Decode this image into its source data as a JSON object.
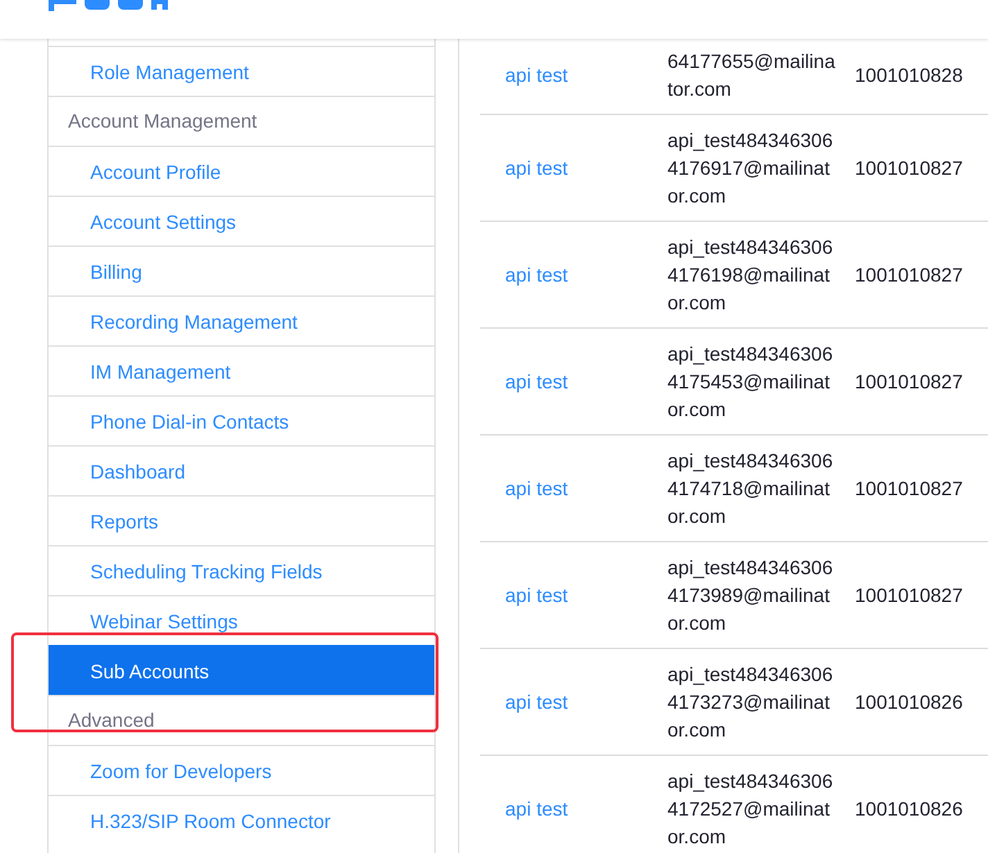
{
  "sidebar": {
    "items": [
      {
        "kind": "link",
        "label": "Role Management",
        "selected": false
      },
      {
        "kind": "section",
        "label": "Account Management"
      },
      {
        "kind": "link",
        "label": "Account Profile",
        "selected": false
      },
      {
        "kind": "link",
        "label": "Account Settings",
        "selected": false
      },
      {
        "kind": "link",
        "label": "Billing",
        "selected": false
      },
      {
        "kind": "link",
        "label": "Recording Management",
        "selected": false
      },
      {
        "kind": "link",
        "label": "IM Management",
        "selected": false
      },
      {
        "kind": "link",
        "label": "Phone Dial-in Contacts",
        "selected": false
      },
      {
        "kind": "link",
        "label": "Dashboard",
        "selected": false
      },
      {
        "kind": "link",
        "label": "Reports",
        "selected": false
      },
      {
        "kind": "link",
        "label": "Scheduling Tracking Fields",
        "selected": false
      },
      {
        "kind": "link",
        "label": "Webinar Settings",
        "selected": false
      },
      {
        "kind": "link",
        "label": "Sub Accounts",
        "selected": true
      },
      {
        "kind": "section",
        "label": "Advanced"
      },
      {
        "kind": "link",
        "label": "Zoom for Developers",
        "selected": false
      },
      {
        "kind": "link",
        "label": "H.323/SIP Room Connector",
        "selected": false
      }
    ]
  },
  "table": {
    "rows": [
      {
        "name": "api test",
        "email": "64177655@mailinator.com",
        "column_3": "1001010828"
      },
      {
        "name": "api test",
        "email": "api_test4843463064176917@mailinator.com",
        "column_3": "1001010827"
      },
      {
        "name": "api test",
        "email": "api_test4843463064176198@mailinator.com",
        "column_3": "1001010827"
      },
      {
        "name": "api test",
        "email": "api_test4843463064175453@mailinator.com",
        "column_3": "1001010827"
      },
      {
        "name": "api test",
        "email": "api_test4843463064174718@mailinator.com",
        "column_3": "1001010827"
      },
      {
        "name": "api test",
        "email": "api_test4843463064173989@mailinator.com",
        "column_3": "1001010827"
      },
      {
        "name": "api test",
        "email": "api_test4843463064173273@mailinator.com",
        "column_3": "1001010826"
      },
      {
        "name": "api test",
        "email": "api_test4843463064172527@mailinator.com",
        "column_3": "1001010826"
      }
    ]
  }
}
